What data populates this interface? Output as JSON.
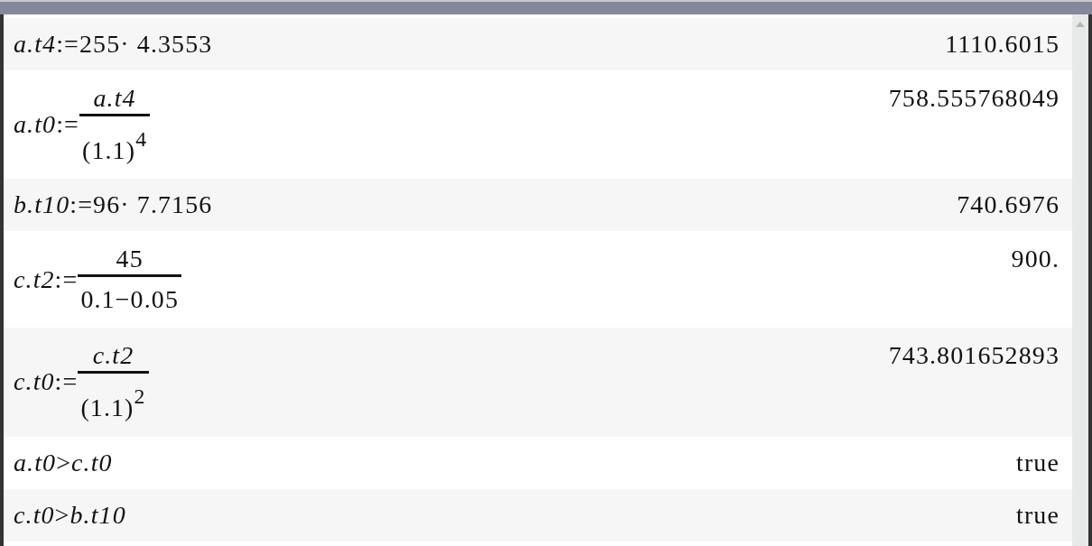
{
  "entries": [
    {
      "kind": "assignment",
      "input": "*a.t4*:=255· 4.3553",
      "result": "1110.6015"
    },
    {
      "kind": "fraction",
      "lhs": "*a.t0*:=",
      "numerator": {
        "kind": "variable",
        "text": "a.t4"
      },
      "denominator": "(1.1)$^{4}$",
      "result": "758.555768049"
    },
    {
      "kind": "assignment",
      "input": "*b.t10*:=96· 7.7156",
      "result": "740.6976"
    },
    {
      "kind": "fraction",
      "lhs": "*c.t2*:=",
      "numerator": {
        "kind": "number",
        "text": "45"
      },
      "denominator": "0.1−0.05",
      "result": "900."
    },
    {
      "kind": "fraction",
      "lhs": "*c.t0*:=",
      "numerator": {
        "kind": "variable",
        "text": "c.t2"
      },
      "denominator": "(1.1)$^{2}$",
      "result": "743.801652893"
    },
    {
      "kind": "comparison",
      "input": "*a.t0*>*c.t0*",
      "result": "true"
    },
    {
      "kind": "comparison",
      "input": "*c.t0*>*b.t10*",
      "result": "true"
    }
  ]
}
